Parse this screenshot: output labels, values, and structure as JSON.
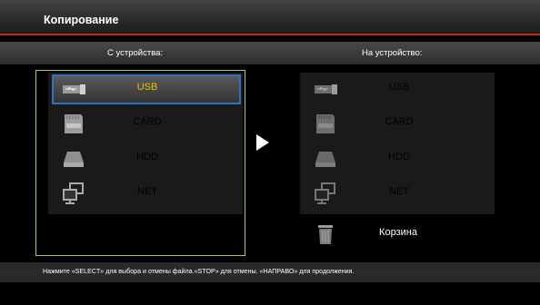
{
  "title": "Копирование",
  "source": {
    "header": "С устройства:",
    "items": [
      {
        "label": "USB",
        "icon": "usb-icon"
      },
      {
        "label": "CARD",
        "icon": "card-icon"
      },
      {
        "label": "HDD",
        "icon": "hdd-icon"
      },
      {
        "label": "NET",
        "icon": "network-icon"
      }
    ],
    "selected": "USB"
  },
  "destination": {
    "header": "На устройство:",
    "items": [
      {
        "label": "USB",
        "icon": "usb-icon"
      },
      {
        "label": "CARD",
        "icon": "card-icon"
      },
      {
        "label": "HDD",
        "icon": "hdd-icon"
      },
      {
        "label": "NET",
        "icon": "network-icon"
      }
    ],
    "trash_label": "Корзина"
  },
  "hint": "Нажмите «SELECT» для выбора и отмены файла.«STOP» для отмены. «НАПРАВО» для продолжения.",
  "colors": {
    "accent_red": "#c8281e",
    "selection_border": "#2f6fc4",
    "selected_text": "#f0c000",
    "frame_yellow": "#c9c33a"
  }
}
